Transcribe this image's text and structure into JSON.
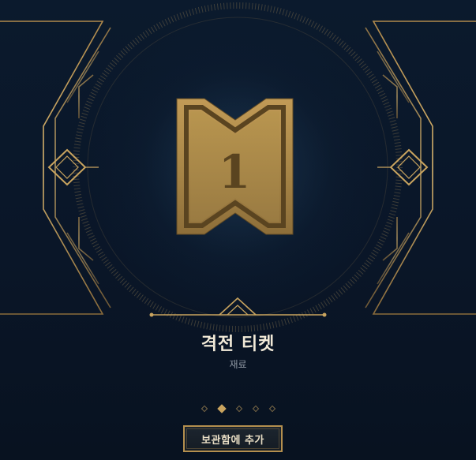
{
  "item": {
    "name": "격전 티켓",
    "category": "재료",
    "icon": "clash-ticket-icon",
    "ticket_number": "1"
  },
  "pager": {
    "count": 5,
    "active_index": 1
  },
  "actions": {
    "add_label": "보관함에 추가"
  },
  "colors": {
    "gold": "#c9a45f",
    "gold_dark": "#6b5530",
    "background": "#0a1628"
  }
}
